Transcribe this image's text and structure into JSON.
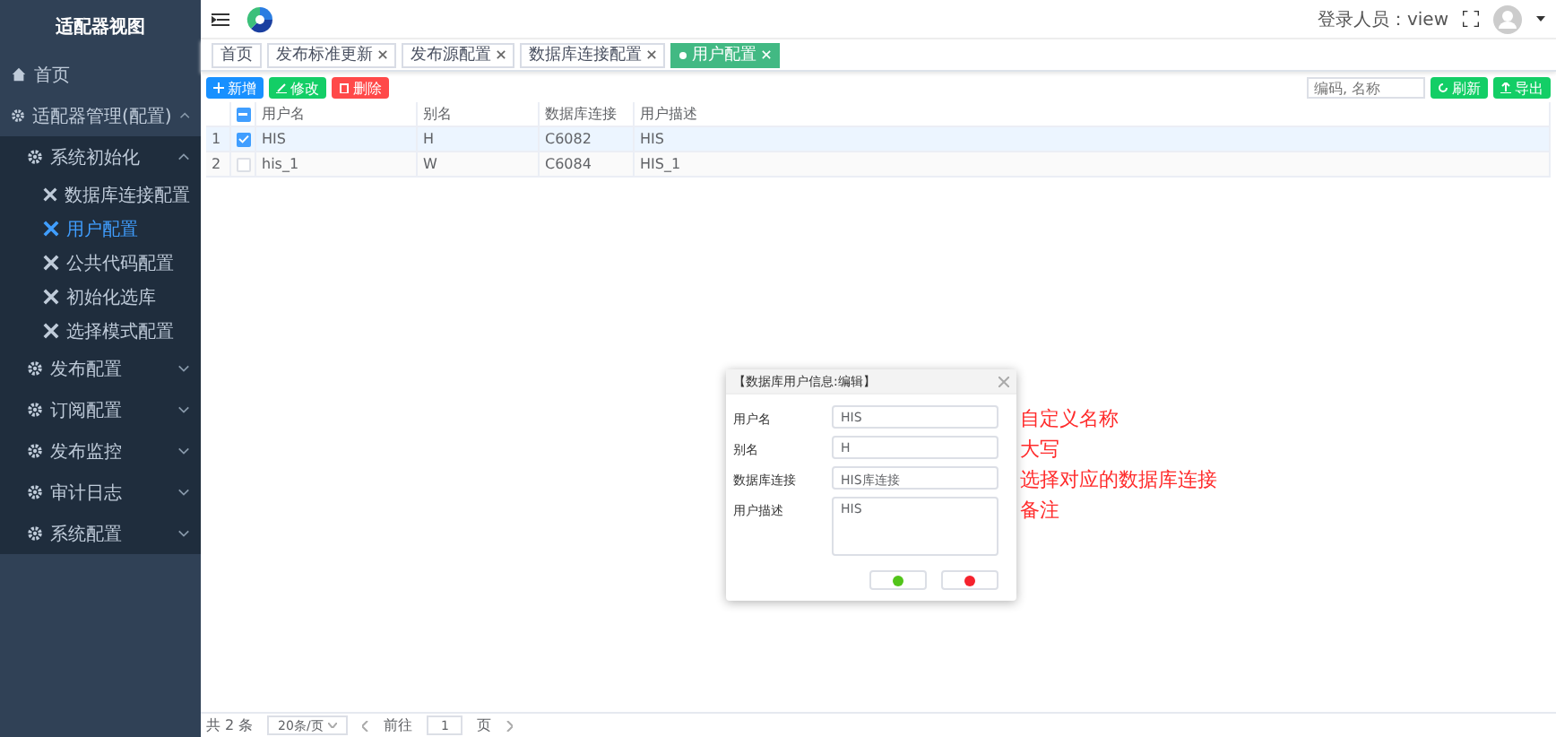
{
  "sidebar": {
    "title": "适配器视图",
    "items": [
      {
        "label": "首页",
        "kind": "link",
        "selected": false
      },
      {
        "label": "适配器管理(配置)",
        "kind": "group",
        "expanded": true,
        "children": [
          {
            "label": "系统初始化",
            "kind": "group",
            "expanded": true,
            "children": [
              {
                "label": "数据库连接配置",
                "kind": "leaf",
                "selected": false
              },
              {
                "label": "用户配置",
                "kind": "leaf",
                "selected": true
              },
              {
                "label": "公共代码配置",
                "kind": "leaf",
                "selected": false
              },
              {
                "label": "初始化选库",
                "kind": "leaf",
                "selected": false
              },
              {
                "label": "选择模式配置",
                "kind": "leaf",
                "selected": false
              }
            ]
          },
          {
            "label": "发布配置",
            "kind": "group",
            "expanded": false
          },
          {
            "label": "订阅配置",
            "kind": "group",
            "expanded": false
          },
          {
            "label": "发布监控",
            "kind": "group",
            "expanded": false
          },
          {
            "label": "审计日志",
            "kind": "group",
            "expanded": false
          },
          {
            "label": "系统配置",
            "kind": "group",
            "expanded": false
          }
        ]
      }
    ]
  },
  "header": {
    "login": "登录人员：view"
  },
  "tabs": [
    {
      "label": "首页",
      "closable": false,
      "selected": false
    },
    {
      "label": "发布标准更新",
      "closable": true,
      "selected": false
    },
    {
      "label": "发布源配置",
      "closable": true,
      "selected": false
    },
    {
      "label": "数据库连接配置",
      "closable": true,
      "selected": false
    },
    {
      "label": "用户配置",
      "closable": true,
      "selected": true
    }
  ],
  "toolbar": {
    "buttons": [
      {
        "label": "新增",
        "kind": "add"
      },
      {
        "label": "修改",
        "kind": "edit"
      },
      {
        "label": "删除",
        "kind": "delete"
      }
    ],
    "search": {
      "placeholder": "编码, 名称"
    },
    "actions": [
      {
        "label": "刷新",
        "kind": "refresh"
      },
      {
        "label": "导出",
        "kind": "export"
      }
    ]
  },
  "table": {
    "select_all": {
      "indeterminate": true
    },
    "columns": [
      "用户名",
      "别名",
      "数据库连接",
      "用户描述"
    ],
    "rows": [
      {
        "index": "1",
        "selected": true,
        "cells": [
          "HIS",
          "H",
          "C6082",
          "HIS"
        ]
      },
      {
        "index": "2",
        "selected": false,
        "cells": [
          "his_1",
          "W",
          "C6084",
          "HIS_1"
        ]
      }
    ]
  },
  "dialog": {
    "title": "【数据库用户信息:编辑】",
    "fields": [
      {
        "label": "用户名",
        "value": "HIS",
        "kind": "input",
        "note": "自定义名称"
      },
      {
        "label": "别名",
        "value": "H",
        "kind": "input",
        "note": "大写"
      },
      {
        "label": "数据库连接",
        "value": "HIS库连接",
        "kind": "select",
        "note": "选择对应的数据库连接"
      },
      {
        "label": "用户描述",
        "value": "HIS",
        "kind": "textarea",
        "note": "备注"
      }
    ],
    "buttons": [
      {
        "kind": "confirm"
      },
      {
        "kind": "cancel"
      }
    ]
  },
  "pagination": {
    "total": "共 2 条",
    "page_size": "20条/页",
    "goto": "前往",
    "page": "1",
    "unit": "页"
  }
}
